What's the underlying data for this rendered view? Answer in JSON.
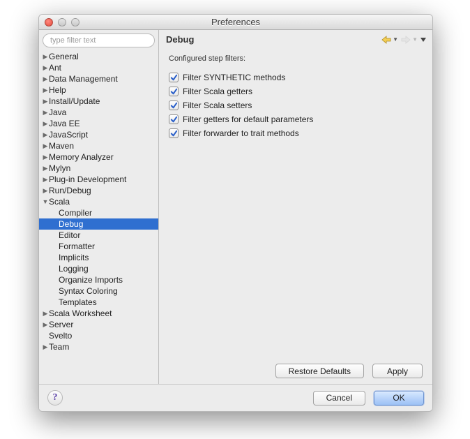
{
  "window": {
    "title": "Preferences"
  },
  "filter": {
    "placeholder": "type filter text"
  },
  "tree": [
    {
      "label": "General",
      "depth": 0,
      "arrow": "right",
      "selected": false
    },
    {
      "label": "Ant",
      "depth": 0,
      "arrow": "right",
      "selected": false
    },
    {
      "label": "Data Management",
      "depth": 0,
      "arrow": "right",
      "selected": false
    },
    {
      "label": "Help",
      "depth": 0,
      "arrow": "right",
      "selected": false
    },
    {
      "label": "Install/Update",
      "depth": 0,
      "arrow": "right",
      "selected": false
    },
    {
      "label": "Java",
      "depth": 0,
      "arrow": "right",
      "selected": false
    },
    {
      "label": "Java EE",
      "depth": 0,
      "arrow": "right",
      "selected": false
    },
    {
      "label": "JavaScript",
      "depth": 0,
      "arrow": "right",
      "selected": false
    },
    {
      "label": "Maven",
      "depth": 0,
      "arrow": "right",
      "selected": false
    },
    {
      "label": "Memory Analyzer",
      "depth": 0,
      "arrow": "right",
      "selected": false
    },
    {
      "label": "Mylyn",
      "depth": 0,
      "arrow": "right",
      "selected": false
    },
    {
      "label": "Plug-in Development",
      "depth": 0,
      "arrow": "right",
      "selected": false
    },
    {
      "label": "Run/Debug",
      "depth": 0,
      "arrow": "right",
      "selected": false
    },
    {
      "label": "Scala",
      "depth": 0,
      "arrow": "down",
      "selected": false
    },
    {
      "label": "Compiler",
      "depth": 1,
      "arrow": "",
      "selected": false
    },
    {
      "label": "Debug",
      "depth": 1,
      "arrow": "",
      "selected": true
    },
    {
      "label": "Editor",
      "depth": 1,
      "arrow": "",
      "selected": false
    },
    {
      "label": "Formatter",
      "depth": 1,
      "arrow": "",
      "selected": false
    },
    {
      "label": "Implicits",
      "depth": 1,
      "arrow": "",
      "selected": false
    },
    {
      "label": "Logging",
      "depth": 1,
      "arrow": "",
      "selected": false
    },
    {
      "label": "Organize Imports",
      "depth": 1,
      "arrow": "",
      "selected": false
    },
    {
      "label": "Syntax Coloring",
      "depth": 1,
      "arrow": "",
      "selected": false
    },
    {
      "label": "Templates",
      "depth": 1,
      "arrow": "",
      "selected": false
    },
    {
      "label": "Scala Worksheet",
      "depth": 0,
      "arrow": "right",
      "selected": false
    },
    {
      "label": "Server",
      "depth": 0,
      "arrow": "right",
      "selected": false
    },
    {
      "label": "Svelto",
      "depth": 0,
      "arrow": "",
      "selected": false
    },
    {
      "label": "Team",
      "depth": 0,
      "arrow": "right",
      "selected": false
    }
  ],
  "page": {
    "title": "Debug",
    "section_label": "Configured step filters:",
    "options": [
      {
        "label": "Filter SYNTHETIC methods",
        "checked": true
      },
      {
        "label": "Filter Scala getters",
        "checked": true
      },
      {
        "label": "Filter Scala setters",
        "checked": true
      },
      {
        "label": "Filter getters for default parameters",
        "checked": true
      },
      {
        "label": "Filter forwarder to trait methods",
        "checked": true
      }
    ],
    "restore_defaults": "Restore Defaults",
    "apply": "Apply"
  },
  "footer": {
    "cancel": "Cancel",
    "ok": "OK"
  },
  "nav": {
    "back_enabled": true,
    "forward_enabled": false
  }
}
